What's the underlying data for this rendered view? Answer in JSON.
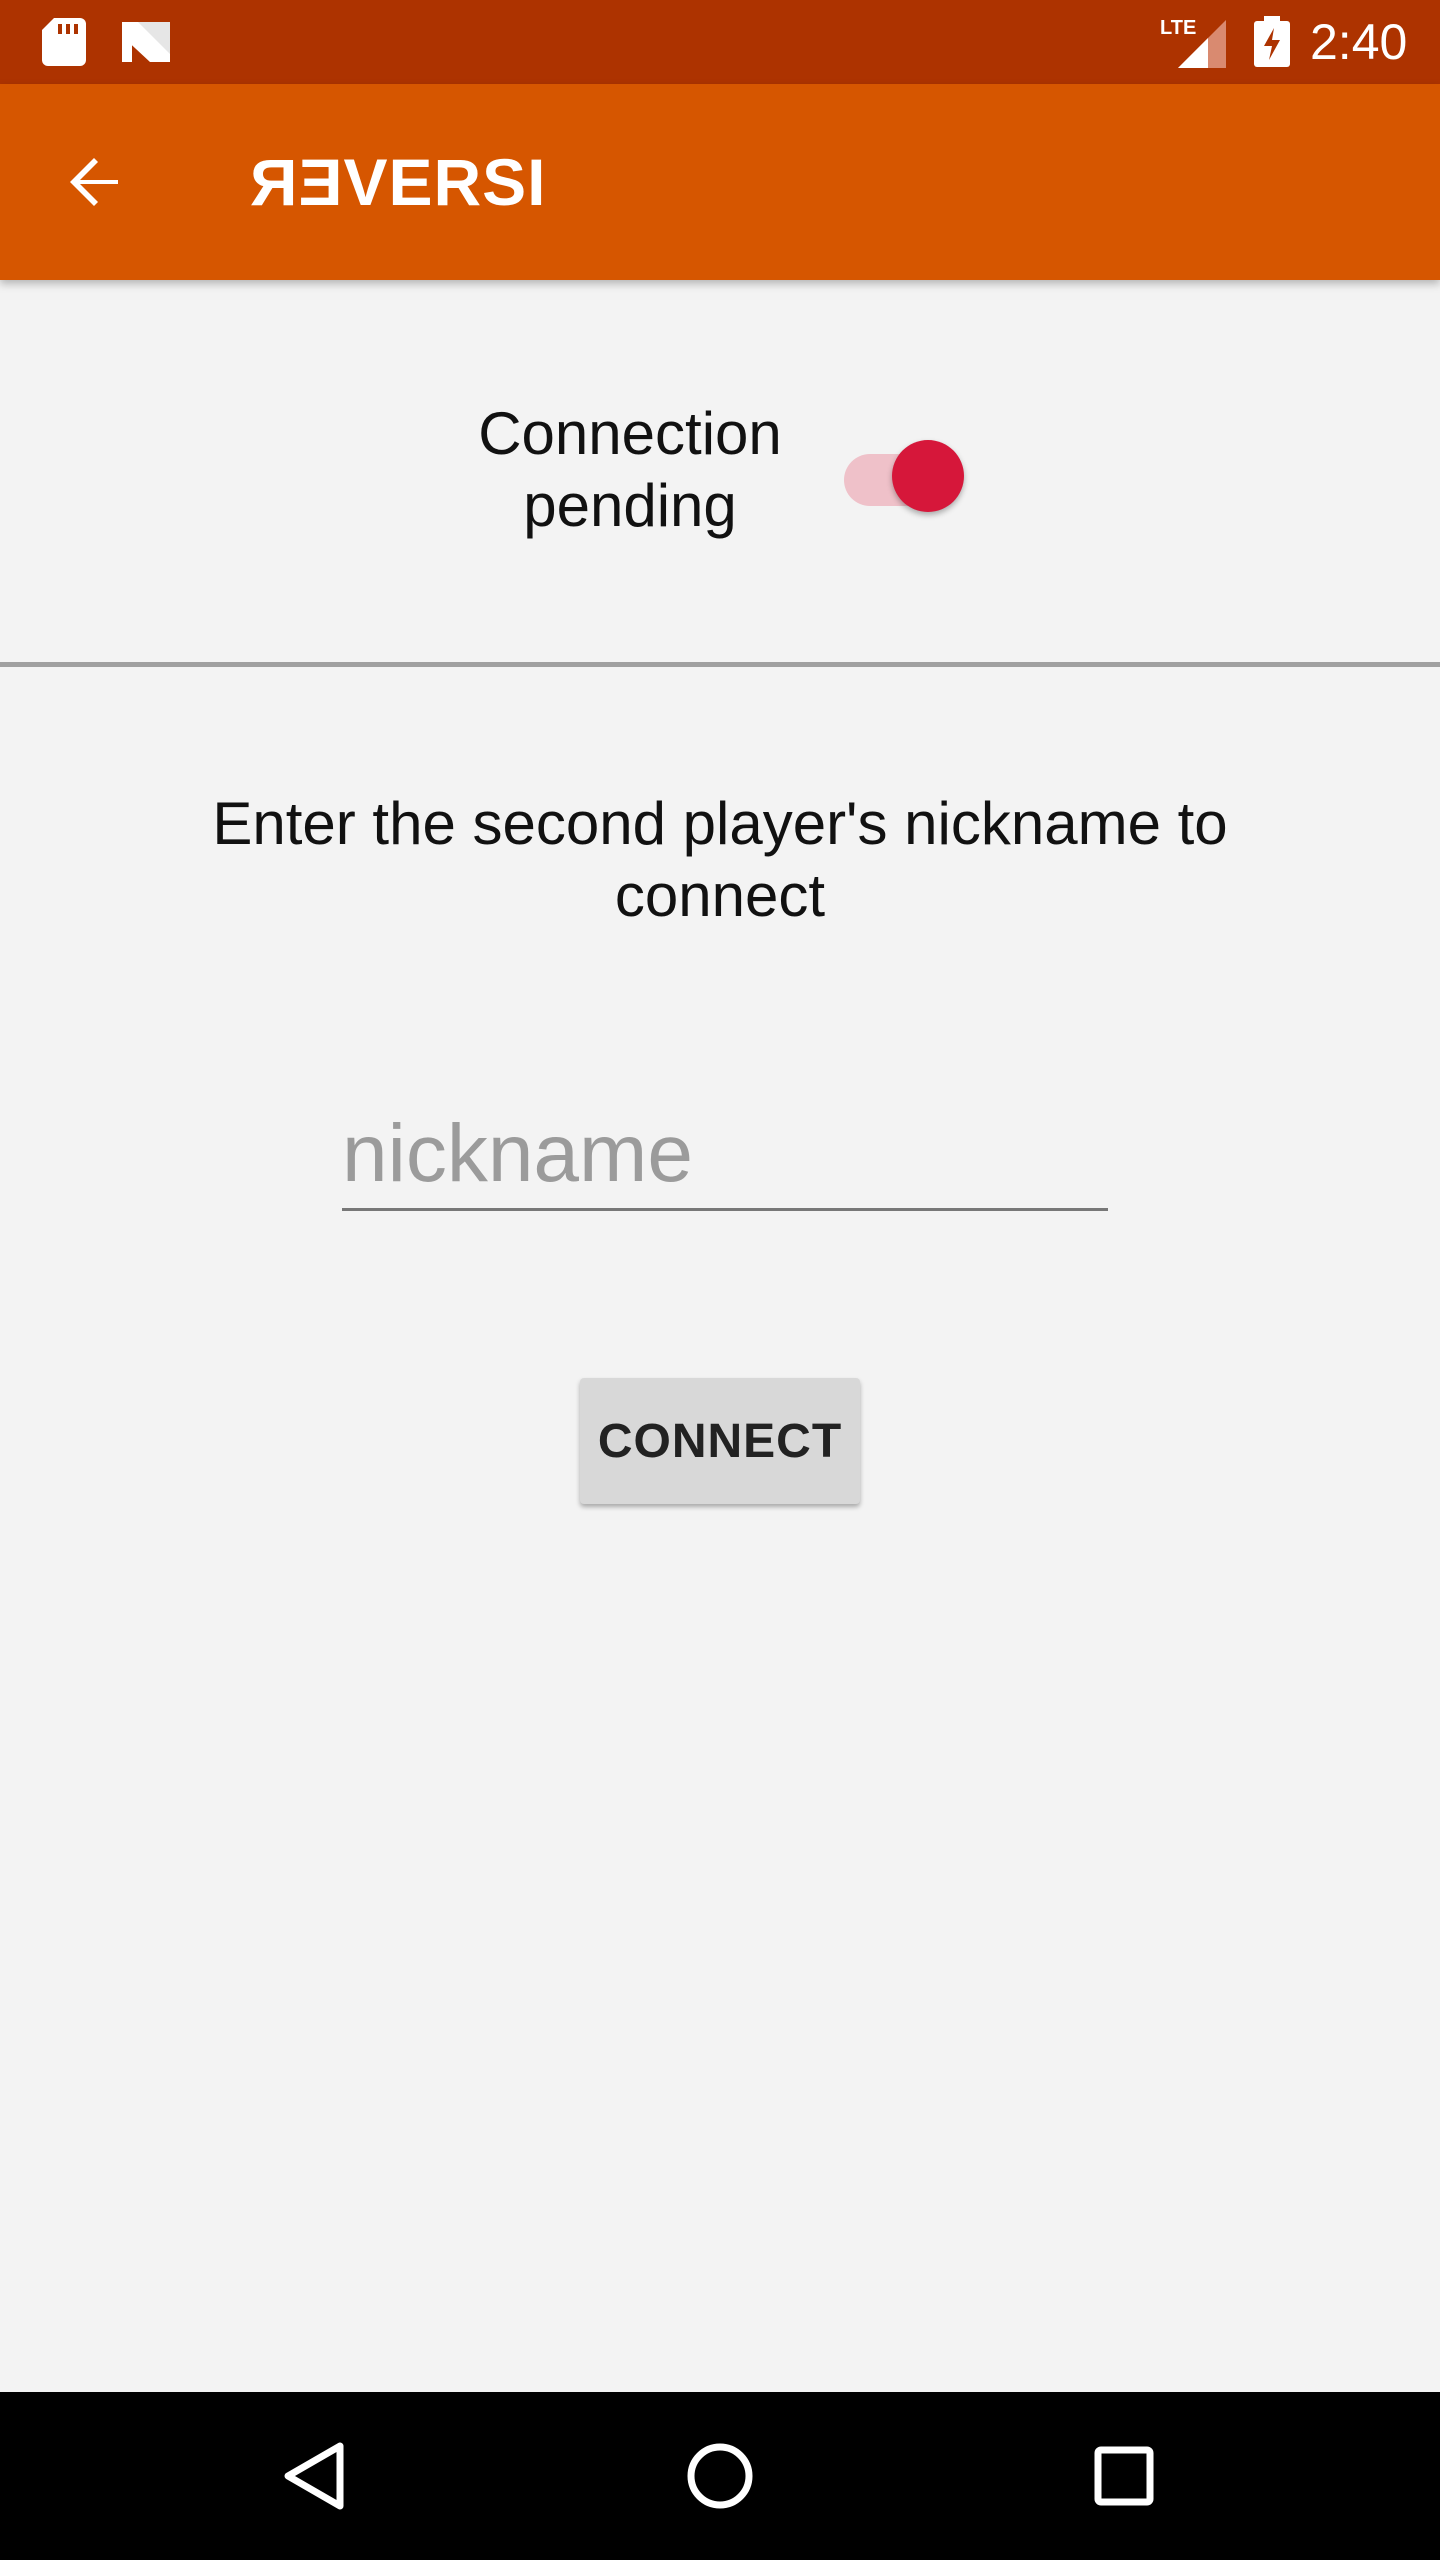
{
  "status_bar": {
    "time": "2:40",
    "network_label": "LTE",
    "icons": [
      "sd-card-icon",
      "n-icon",
      "lte-signal-icon",
      "battery-charging-icon"
    ]
  },
  "app_bar": {
    "title": "ЯƎVERSI",
    "back_icon": "arrow-back-icon",
    "background_color": "#d65600"
  },
  "connection": {
    "label": "Connection pending",
    "toggle_on": true,
    "toggle_color": "#d6173a"
  },
  "instruction": "Enter the second player's nickname to connect",
  "nickname_input": {
    "placeholder": "nickname",
    "value": ""
  },
  "connect_button": {
    "label": "CONNECT"
  },
  "nav_bar": {
    "icons": [
      "nav-back-icon",
      "nav-home-icon",
      "nav-recents-icon"
    ]
  }
}
